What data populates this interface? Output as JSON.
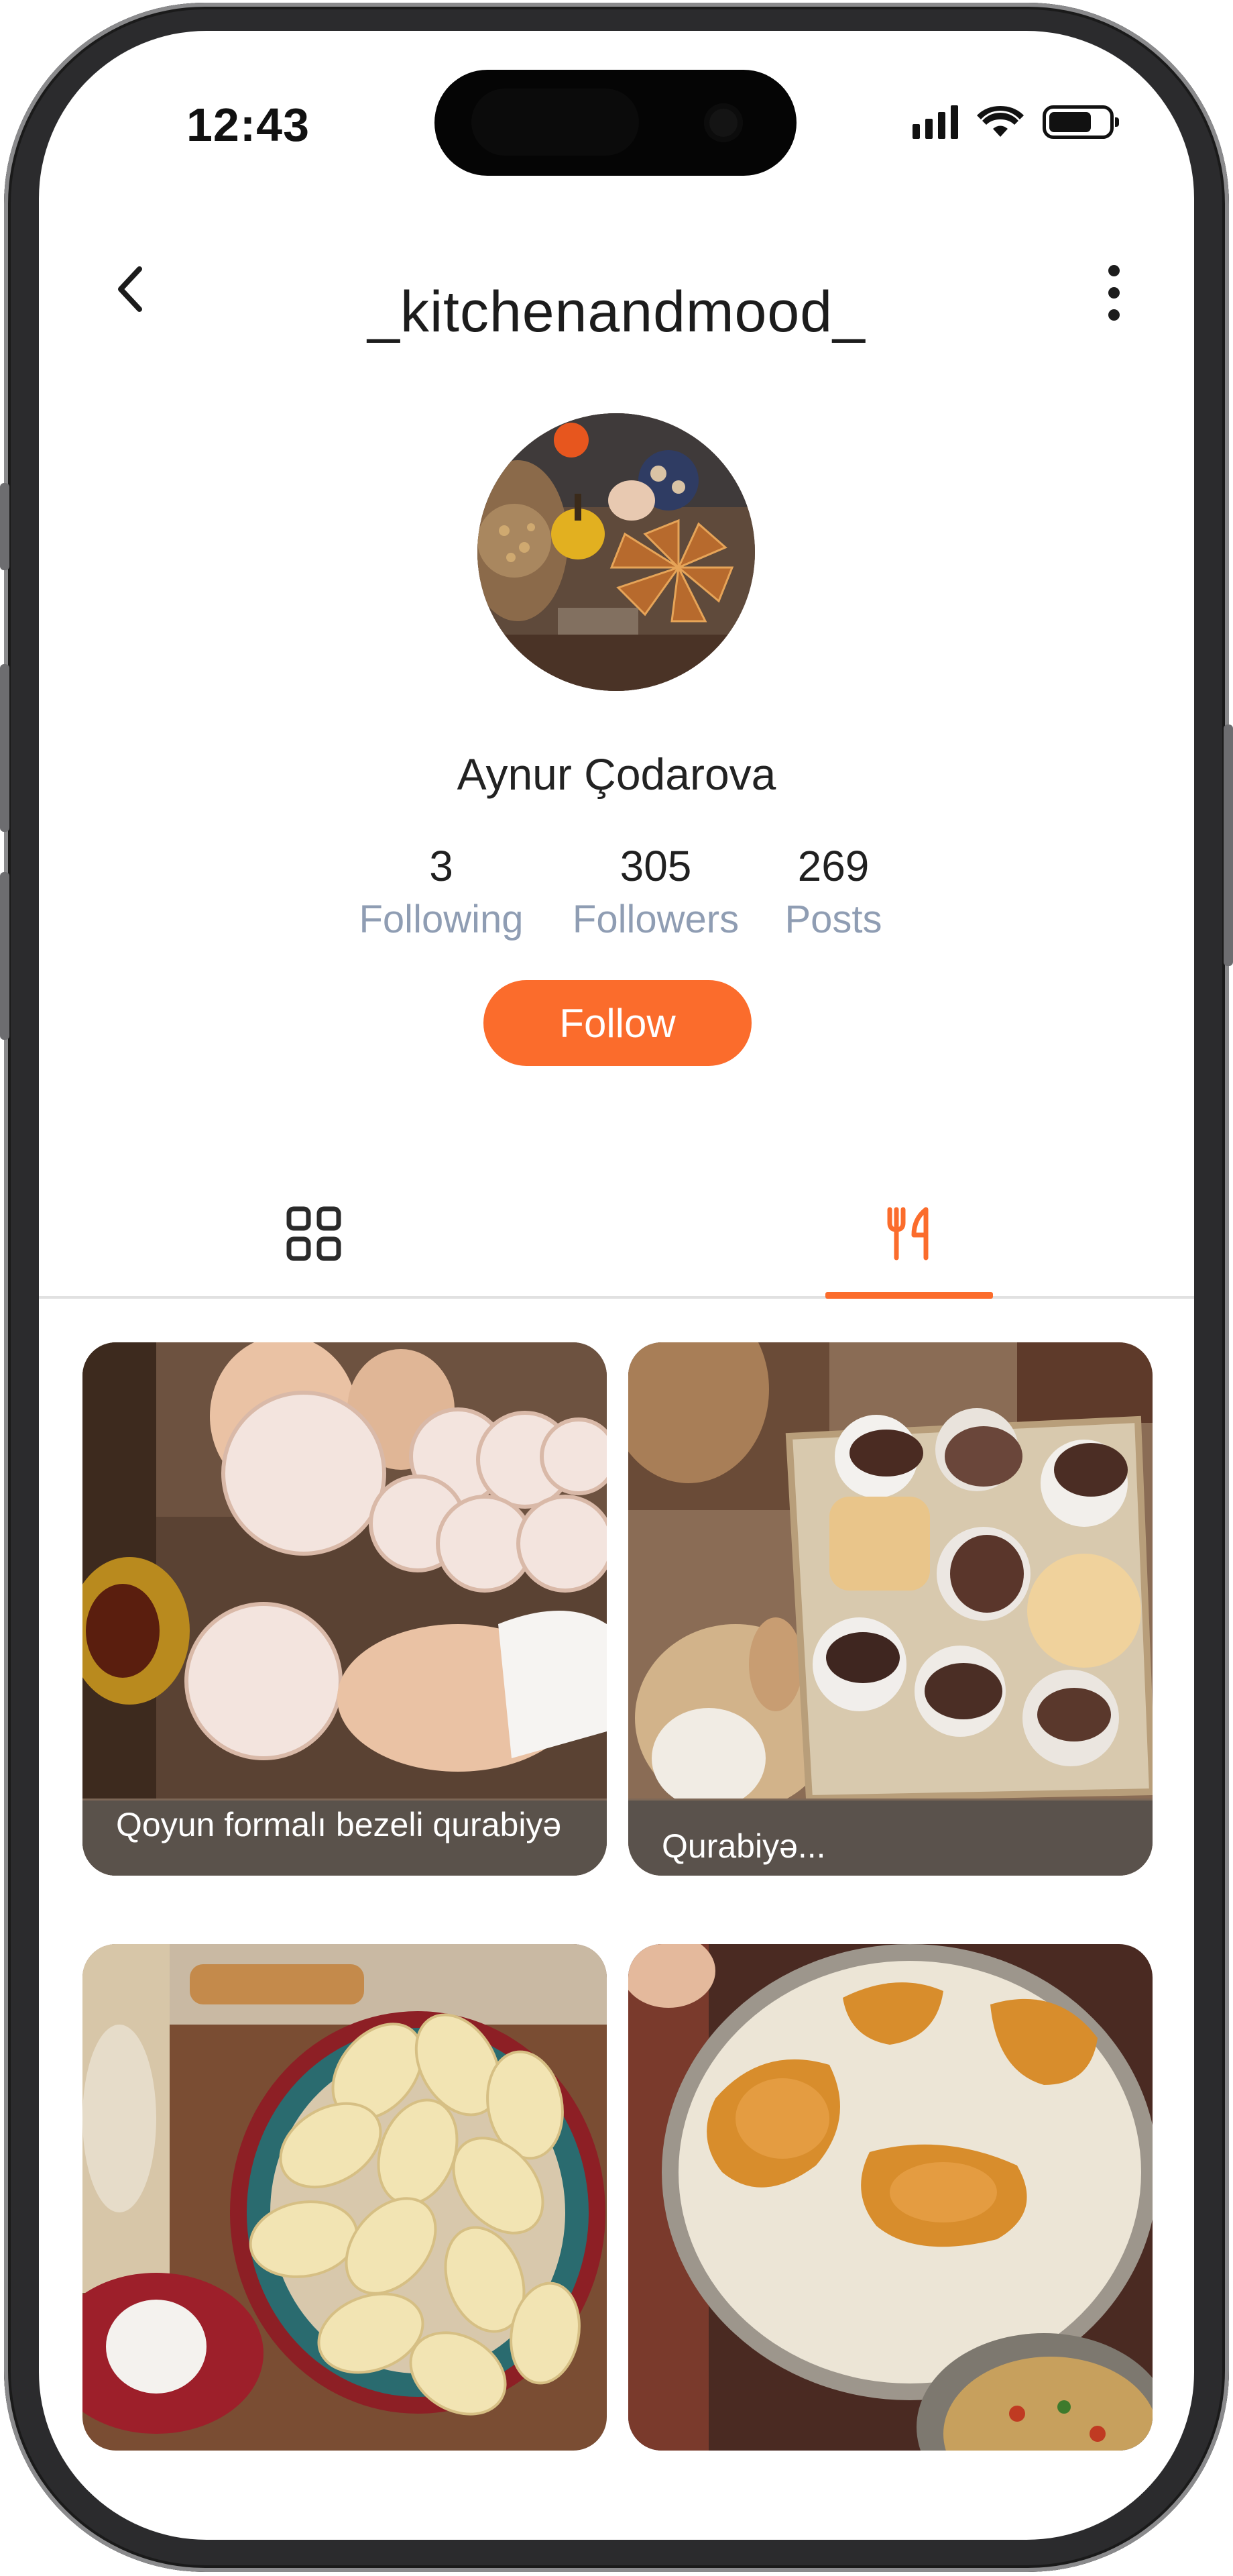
{
  "status_bar": {
    "time": "12:43"
  },
  "header": {
    "title": "_kitchenandmood_"
  },
  "profile": {
    "name": "Aynur Çodarova",
    "stats": [
      {
        "value": "3",
        "label": "Following"
      },
      {
        "value": "305",
        "label": "Followers"
      },
      {
        "value": "269",
        "label": "Posts"
      }
    ],
    "follow_label": "Follow"
  },
  "tabs": [
    {
      "icon": "grid-icon",
      "active": false
    },
    {
      "icon": "fork-knife-icon",
      "active": true
    }
  ],
  "posts": [
    {
      "caption": "Qoyun formalı bezeli qurabiyə"
    },
    {
      "caption": "Qurabiyə..."
    },
    {
      "caption": ""
    },
    {
      "caption": ""
    }
  ],
  "colors": {
    "accent": "#fb6c2c",
    "muted_label": "#8f9db3"
  }
}
